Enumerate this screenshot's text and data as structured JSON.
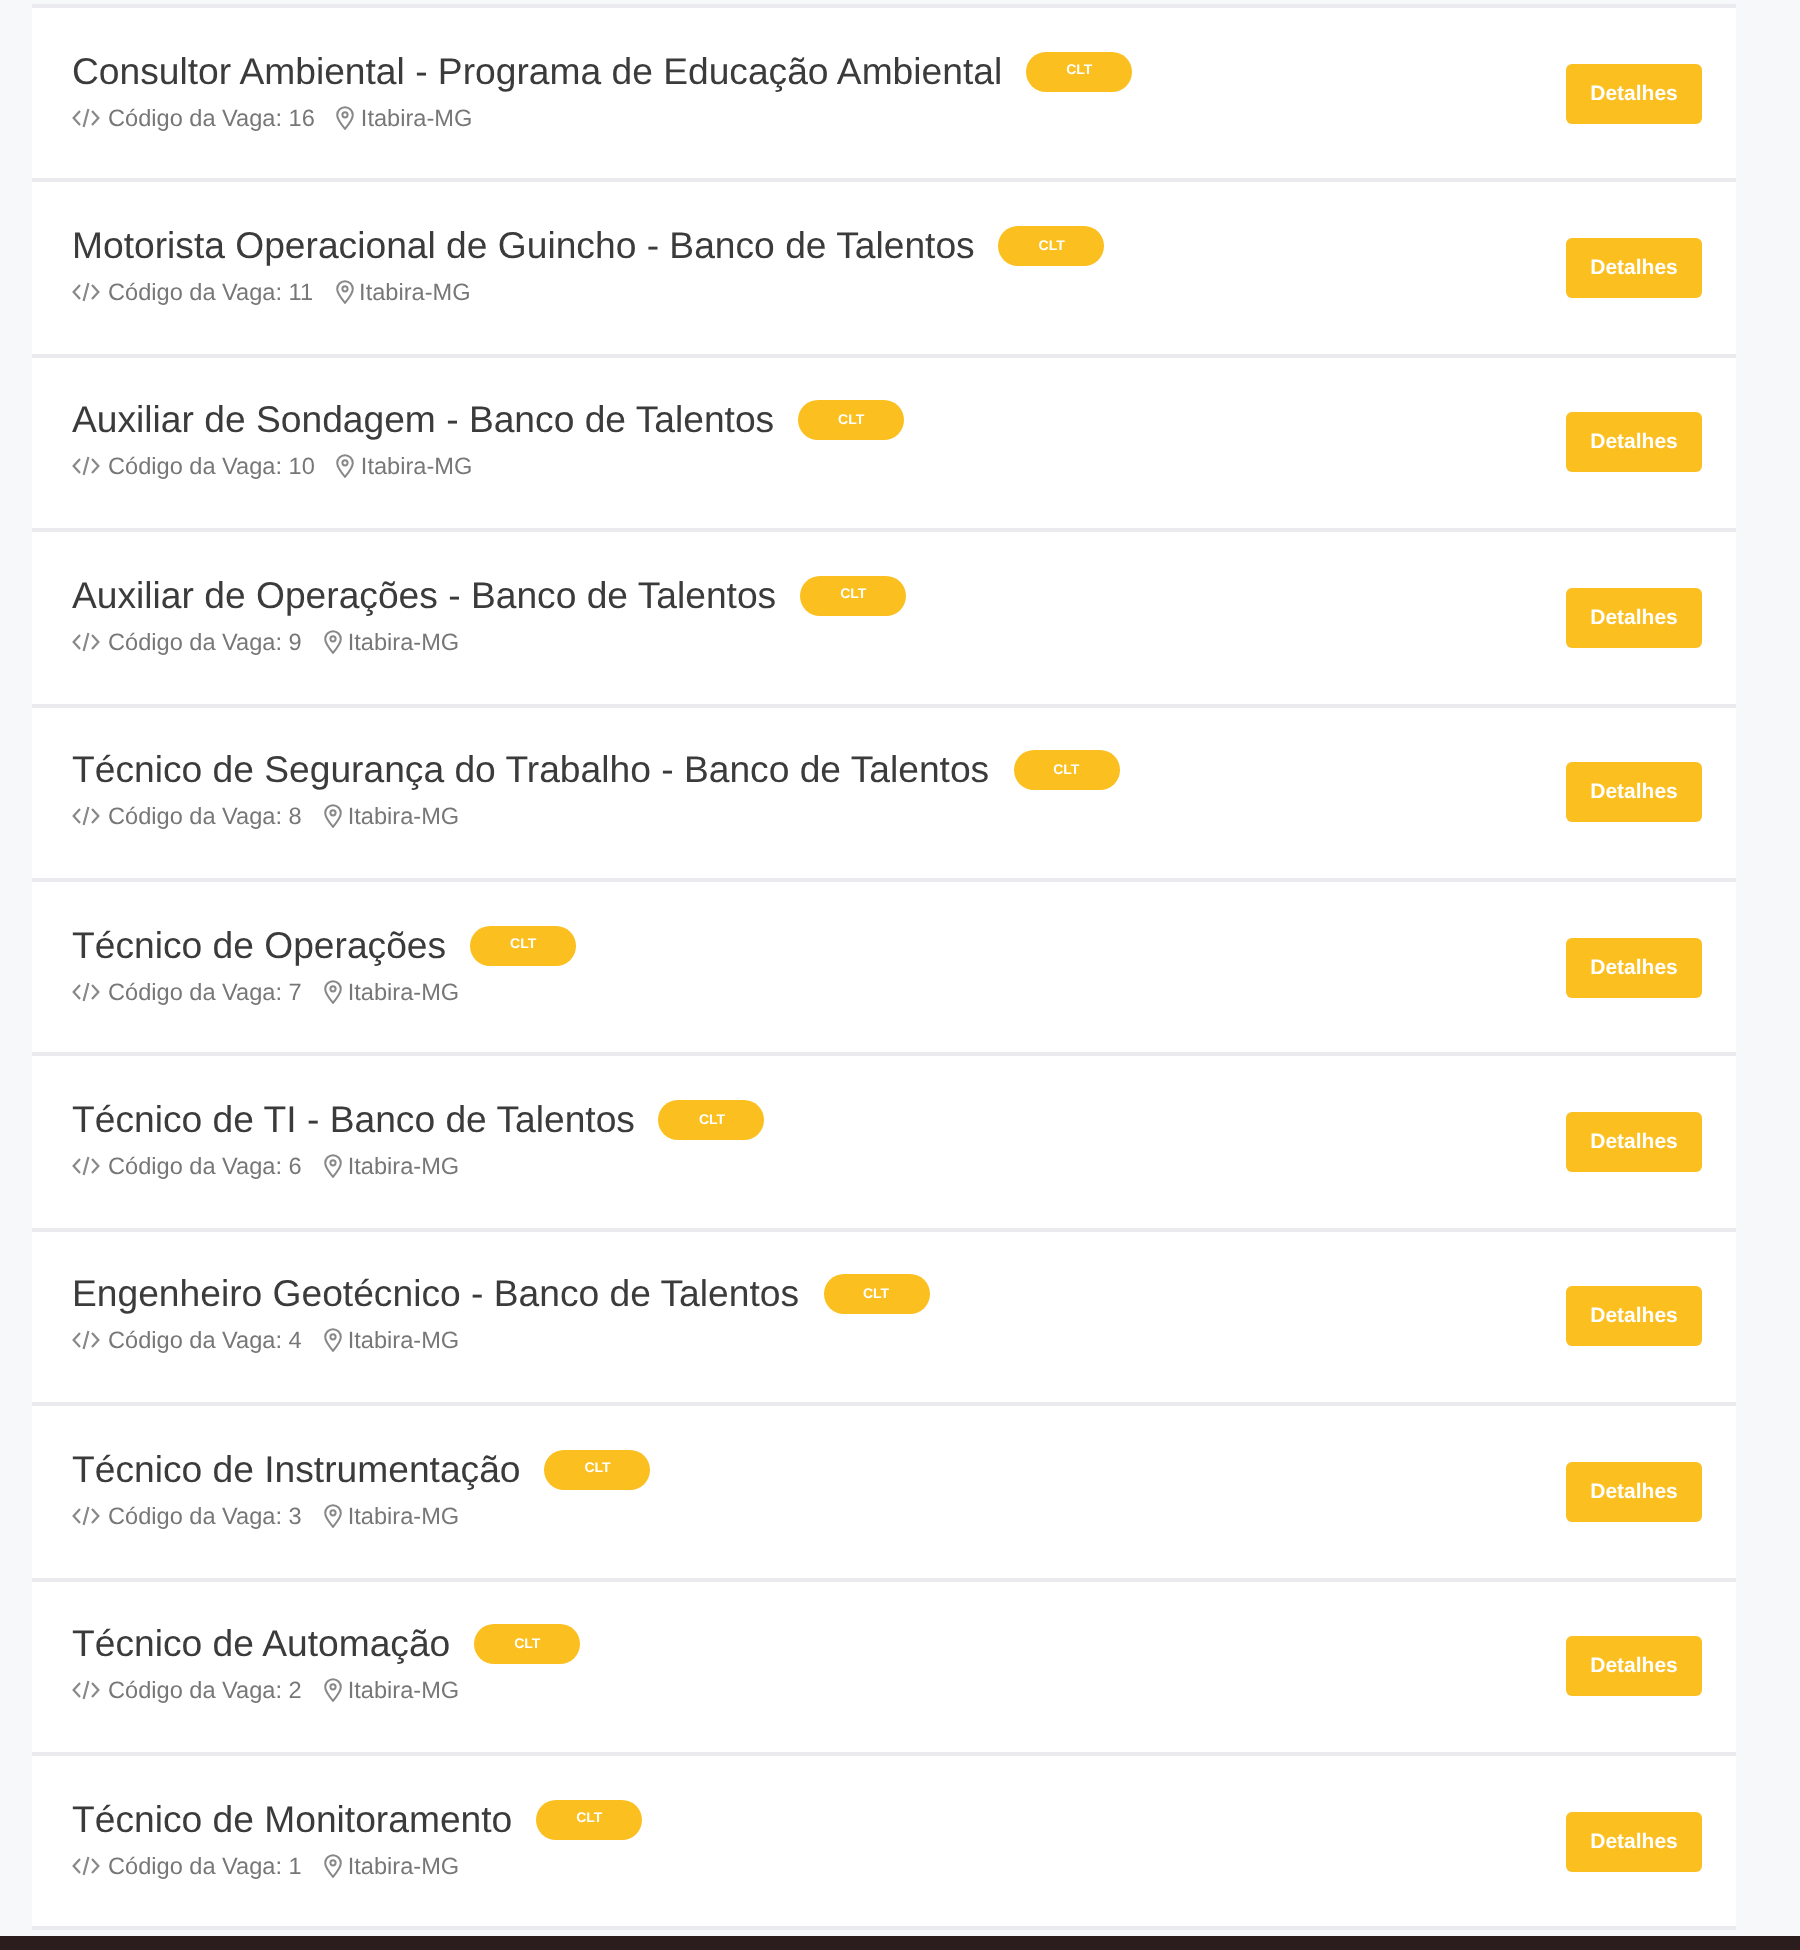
{
  "jobs": [
    {
      "title": "Consultor Ambiental - Programa de Educação Ambiental",
      "contract": "CLT",
      "code": "Código da Vaga: 16",
      "location": "Itabira-MG",
      "button": "Detalhes"
    },
    {
      "title": "Motorista Operacional de Guincho - Banco de Talentos",
      "contract": "CLT",
      "code": "Código da Vaga: 11",
      "location": "Itabira-MG",
      "button": "Detalhes"
    },
    {
      "title": "Auxiliar de Sondagem - Banco de Talentos",
      "contract": "CLT",
      "code": "Código da Vaga: 10",
      "location": "Itabira-MG",
      "button": "Detalhes"
    },
    {
      "title": "Auxiliar de Operações - Banco de Talentos",
      "contract": "CLT",
      "code": "Código da Vaga: 9",
      "location": "Itabira-MG",
      "button": "Detalhes"
    },
    {
      "title": "Técnico de Segurança do Trabalho - Banco de Talentos",
      "contract": "CLT",
      "code": "Código da Vaga: 8",
      "location": "Itabira-MG",
      "button": "Detalhes"
    },
    {
      "title": "Técnico de Operações",
      "contract": "CLT",
      "code": "Código da Vaga: 7",
      "location": "Itabira-MG",
      "button": "Detalhes"
    },
    {
      "title": "Técnico de TI - Banco de Talentos",
      "contract": "CLT",
      "code": "Código da Vaga: 6",
      "location": "Itabira-MG",
      "button": "Detalhes"
    },
    {
      "title": "Engenheiro Geotécnico - Banco de Talentos",
      "contract": "CLT",
      "code": "Código da Vaga: 4",
      "location": "Itabira-MG",
      "button": "Detalhes"
    },
    {
      "title": "Técnico de Instrumentação",
      "contract": "CLT",
      "code": "Código da Vaga: 3",
      "location": "Itabira-MG",
      "button": "Detalhes"
    },
    {
      "title": "Técnico de Automação",
      "contract": "CLT",
      "code": "Código da Vaga: 2",
      "location": "Itabira-MG",
      "button": "Detalhes"
    },
    {
      "title": "Técnico de Monitoramento",
      "contract": "CLT",
      "code": "Código da Vaga: 1",
      "location": "Itabira-MG",
      "button": "Detalhes"
    }
  ]
}
